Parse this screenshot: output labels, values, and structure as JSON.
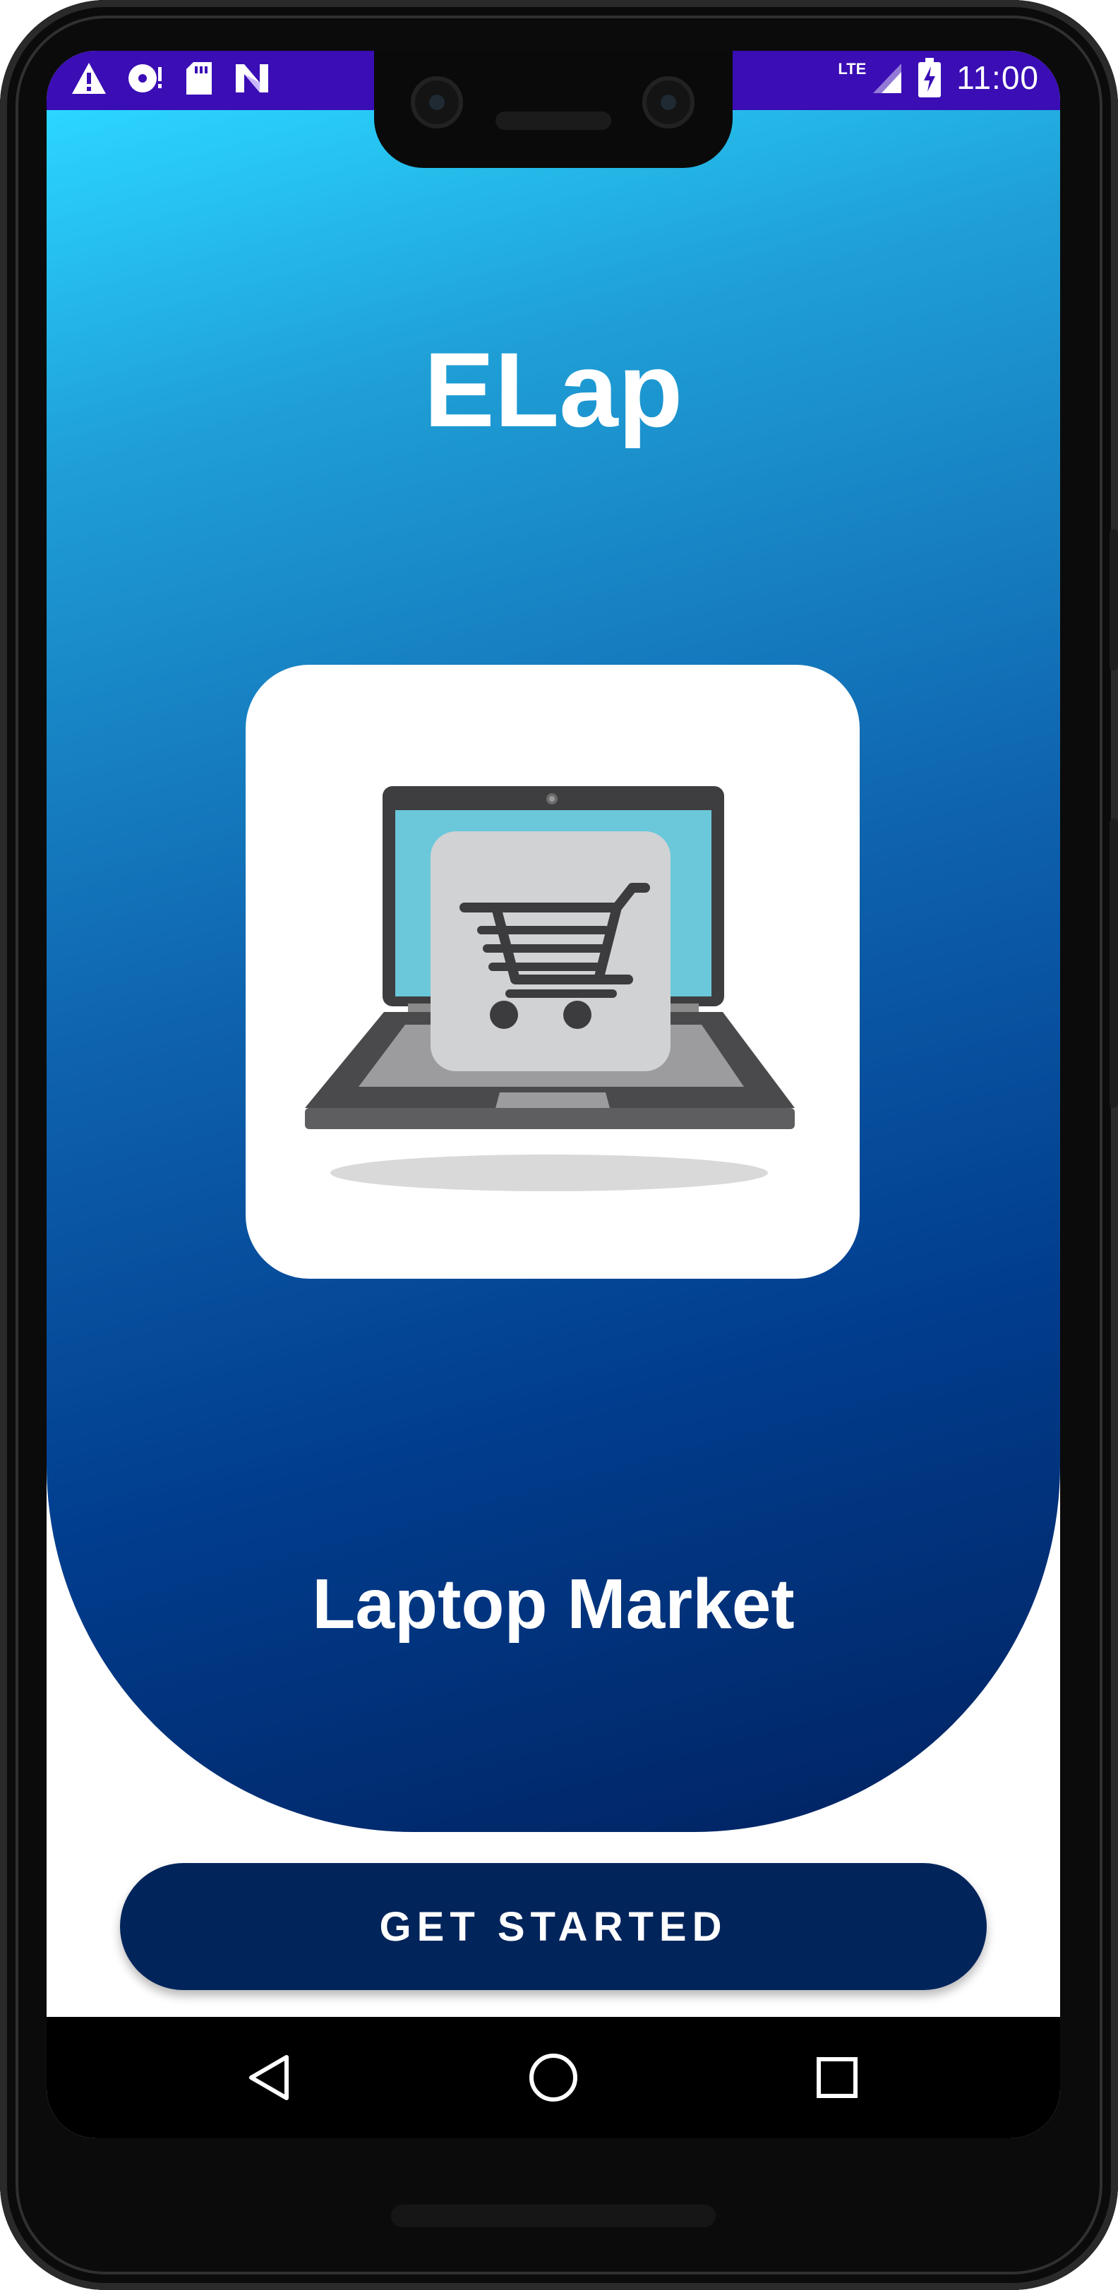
{
  "status_bar": {
    "network_label": "LTE",
    "time": "11:00",
    "icons": [
      "warning-icon",
      "disc-icon",
      "sd-card-icon",
      "n-logo-icon",
      "signal-icon",
      "battery-charging-icon"
    ],
    "background_color": "#3a0db5"
  },
  "hero": {
    "title": "ELap",
    "subtitle": "Laptop Market",
    "logo_icon": "laptop-shopping-cart-icon",
    "gradient_colors": [
      "#2bd6ff",
      "#0e62ae",
      "#012260"
    ]
  },
  "actions": {
    "get_started_label": "GET STARTED",
    "button_color": "#01245b"
  },
  "nav_bar": {
    "icons": [
      "back-icon",
      "home-icon",
      "recents-icon"
    ]
  }
}
